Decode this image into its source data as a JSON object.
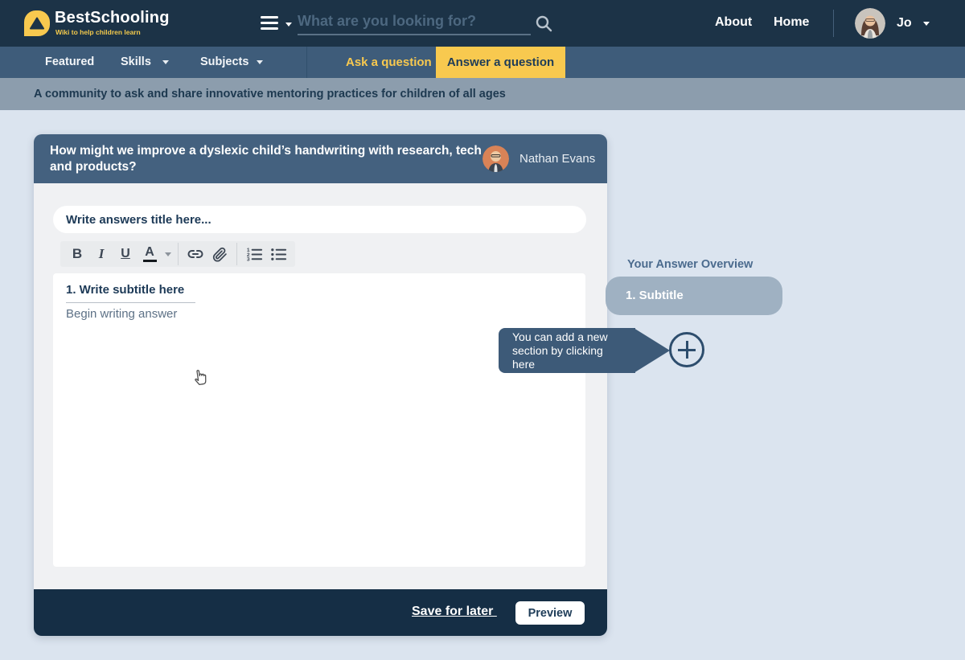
{
  "colors": {
    "header_bg": "#1c3347",
    "nav_bg": "#3e5c7a",
    "banner_bg": "#8c9dad",
    "page_bg": "#dbe4ef",
    "card_body_bg": "#f0f1f3",
    "card_header_bg": "#44617f",
    "card_footer_bg": "#152e45",
    "accent_yellow": "#f8c94f",
    "pill_bg": "#9fb1c2",
    "tooltip_bg": "#3d5a78",
    "ink_navy": "#1d3a57",
    "muted_text": "#5d7186"
  },
  "header": {
    "brand": "BestSchooling",
    "tagline": "Wiki to help children learn",
    "search_placeholder": "What are you looking for?",
    "links": {
      "about": "About",
      "home": "Home"
    },
    "user_name": "Jo",
    "icons": [
      "logo-triangle-icon",
      "hamburger-icon",
      "search-icon",
      "chevron-down-icon"
    ]
  },
  "nav": {
    "featured": "Featured",
    "skills": "Skills",
    "subjects": "Subjects",
    "ask": "Ask a question",
    "answer": "Answer a question"
  },
  "banner": {
    "text": "A community to ask and share innovative mentoring practices for children of all ages"
  },
  "question": {
    "title": "How might we improve a dyslexic child’s handwriting with research, tech and products?",
    "author": "Nathan Evans"
  },
  "editor": {
    "title_placeholder": "Write answers title here...",
    "toolbar": {
      "bold": "B",
      "italic": "I",
      "underline": "U",
      "text_color": "A",
      "icon_names": [
        "link-icon",
        "paperclip-icon",
        "ordered-list-icon",
        "bullet-list-icon"
      ]
    },
    "subtitle": "1. Write subtitle here",
    "body_placeholder": "Begin writing answer"
  },
  "overview": {
    "title": "Your Answer Overview",
    "sections": [
      {
        "label": "1. Subtitle"
      }
    ],
    "tooltip": "You can add a new section by clicking here"
  },
  "footer": {
    "save": "Save for later ",
    "preview": "Preview"
  }
}
